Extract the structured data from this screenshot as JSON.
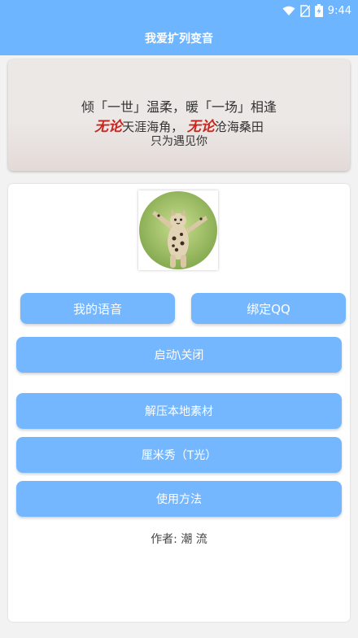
{
  "status_bar": {
    "time": "9:44",
    "icons": [
      "wifi-icon",
      "no-sim-icon",
      "battery-charging-icon"
    ]
  },
  "app_bar": {
    "title": "我爱扩列变音"
  },
  "banner": {
    "line1": "倾「一世」温柔，暖「一场」相逢",
    "line2_highlight1": "无论",
    "line2_text1": "天涯海角，",
    "line2_highlight2": "无论",
    "line2_text2": "沧海桑田",
    "line3": "只为遇见你"
  },
  "profile": {
    "avatar": "cat-avatar"
  },
  "buttons": {
    "my_voice": "我的语音",
    "bind_qq": "绑定QQ",
    "toggle": "启动\\关闭",
    "extract": "解压本地素材",
    "centimeter_show": "厘米秀（T光）",
    "usage": "使用方法"
  },
  "footer": {
    "author": "作者: 潮 流"
  },
  "colors": {
    "primary": "#6eb5ff",
    "button": "#74b7ff",
    "highlight_red": "#c8261e"
  }
}
